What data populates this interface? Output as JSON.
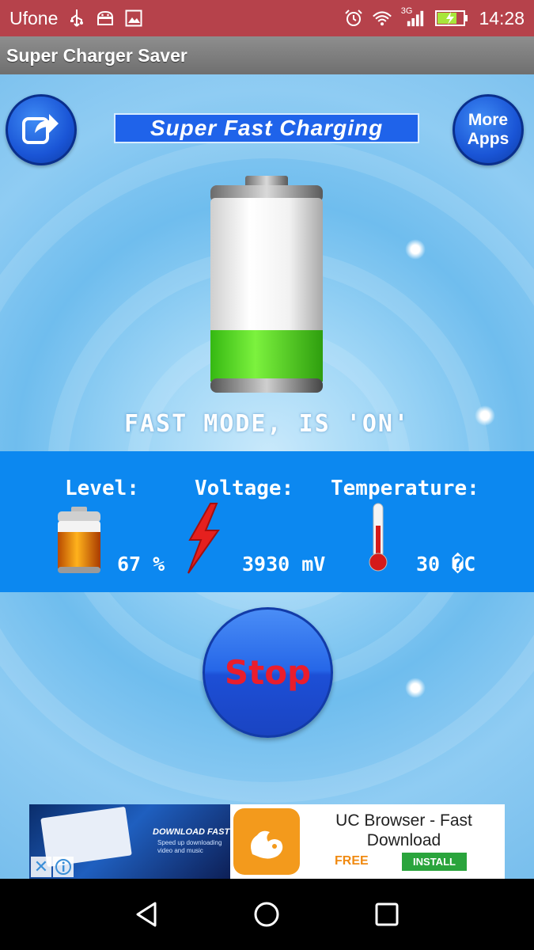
{
  "status_bar": {
    "carrier": "Ufone",
    "network": "3G",
    "time": "14:28",
    "icons": [
      "usb-icon",
      "android-debug-icon",
      "image-icon",
      "alarm-icon",
      "wifi-icon",
      "signal-icon",
      "battery-charging-icon"
    ]
  },
  "title_bar": {
    "title": "Super Charger Saver"
  },
  "main": {
    "banner": "Super Fast Charging",
    "more_apps": "More Apps",
    "share_icon": "share-icon",
    "battery_fill": 0.28,
    "fast_mode_text": "FAST MODE, IS 'ON'"
  },
  "info": {
    "level_label": "Level:",
    "level_value": "67 %",
    "voltage_label": "Voltage:",
    "voltage_value": "3930 mV",
    "temperature_label": "Temperature:",
    "temperature_value": "30 �C"
  },
  "stop_button": {
    "label": "Stop"
  },
  "ad": {
    "title": "UC Browser - Fast Download",
    "free": "FREE",
    "install": "INSTALL",
    "image_text": "DOWNLOAD FAST",
    "image_subtext": "Speed up downloading video and music"
  },
  "nav": {
    "icons": [
      "back-icon",
      "home-icon",
      "recents-icon"
    ]
  },
  "colors": {
    "status_bar": "#b6424b",
    "panel": "#0c88f0",
    "accent_blue": "#1f63ea",
    "stop_text": "#ea1d2c"
  }
}
